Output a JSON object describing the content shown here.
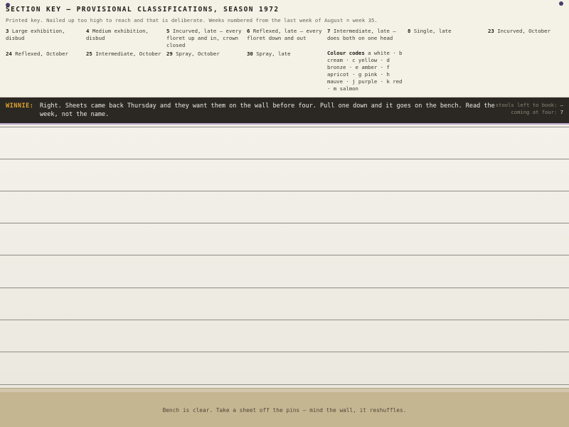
{
  "key": {
    "title": "SECTION KEY — PROVISIONAL CLASSIFICATIONS, SEASON 1972",
    "subtitle": "Printed key. Nailed up too high to reach and that is deliberate. Weeks numbered from the last week of August = week 35.",
    "classes": [
      {
        "num": "3",
        "desc": "Large exhibition, disbud"
      },
      {
        "num": "4",
        "desc": "Medium exhibition, disbud"
      },
      {
        "num": "5",
        "desc": "Incurved, late — every floret up and in, crown closed"
      },
      {
        "num": "6",
        "desc": "Reflexed, late — every floret down and out"
      },
      {
        "num": "7",
        "desc": "Intermediate, late — does both on one head"
      },
      {
        "num": "8",
        "desc": "Single, late"
      },
      {
        "num": "23",
        "desc": "Incurved, October"
      },
      {
        "num": "24",
        "desc": "Reflexed, October"
      },
      {
        "num": "25",
        "desc": "Intermediate, October"
      },
      {
        "num": "29",
        "desc": "Spray, October"
      },
      {
        "num": "30",
        "desc": "Spray, late"
      }
    ],
    "colour_codes_label": "Colour codes",
    "colour_codes_text": "a white · b cream · c yellow · d bronze · e amber · f apricot · g pink · h mauve · j purple · k red · m salmon"
  },
  "dialogue": {
    "speaker": "WINNIE:",
    "text": "Right. Sheets came back Thursday and they want them on the wall before four. Pull one down and it goes on the bench. Read the week, not the name.",
    "stools_label": "stools left to book:",
    "stools_value": "—",
    "coming_label": "coming at four:",
    "coming_value": "7"
  },
  "bench": {
    "message": "Bench is clear. Take a sheet off the pins — mind the wall, it reshuffles."
  },
  "colors": {
    "pin": "#4a3c6b",
    "speaker": "#e0a62e",
    "dialogue_bg": "#2b2824",
    "bench": "#c5b692"
  }
}
